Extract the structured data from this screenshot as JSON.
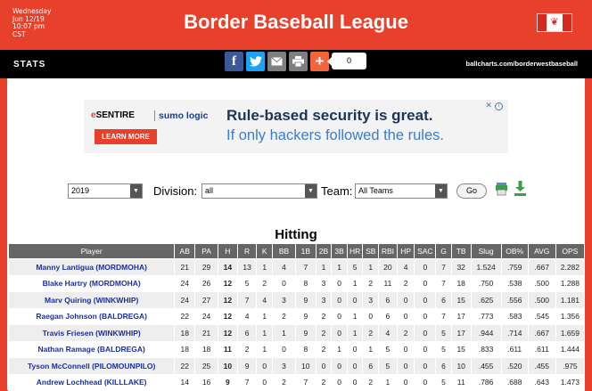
{
  "header": {
    "datetime": [
      "Wednesday",
      "Jun 12/19",
      "10:07 pm",
      "CST"
    ],
    "title": "Border Baseball League"
  },
  "statsbar": {
    "label": "STATS",
    "share_count": "0",
    "site_url": "ballcharts.com/borderwestbaseball",
    "share_buttons": [
      {
        "icon": "facebook-icon",
        "glyph": "f",
        "color": "#3b5998"
      },
      {
        "icon": "twitter-icon",
        "glyph": "t",
        "color": "#1da1f2"
      },
      {
        "icon": "email-icon",
        "glyph": "✉",
        "color": "#7f7f7f"
      },
      {
        "icon": "print-icon",
        "glyph": "⎙",
        "color": "#7f7f7f"
      },
      {
        "icon": "plus-icon",
        "glyph": "+",
        "color": "#f0663a"
      }
    ]
  },
  "ad": {
    "logo1_e": "e",
    "logo1_rest": "SENTIRE",
    "logo2": "sumo logic",
    "button": "LEARN MORE",
    "headline": "Rule-based security is great.",
    "subline": "If only hackers followed the rules."
  },
  "filters": {
    "year": "2019",
    "division_label": "Division:",
    "division": "all",
    "team_label": "Team:",
    "team": "All Teams",
    "go": "Go"
  },
  "table": {
    "title": "Hitting",
    "columns": [
      "Player",
      "AB",
      "PA",
      "H",
      "R",
      "K",
      "BB",
      "1B",
      "2B",
      "3B",
      "HR",
      "SB",
      "RBI",
      "HP",
      "SAC",
      "G",
      "TB",
      "Slug",
      "OB%",
      "AVG",
      "OPS"
    ],
    "rows": [
      [
        "Manny Lantigua (MORDMOHA)",
        "21",
        "29",
        "14",
        "13",
        "1",
        "4",
        "7",
        "1",
        "1",
        "5",
        "1",
        "20",
        "4",
        "0",
        "7",
        "32",
        "1.524",
        ".759",
        ".667",
        "2.282"
      ],
      [
        "Blake Hartry (MORDMOHA)",
        "24",
        "26",
        "12",
        "5",
        "2",
        "0",
        "8",
        "3",
        "0",
        "1",
        "2",
        "11",
        "2",
        "0",
        "7",
        "18",
        ".750",
        ".538",
        ".500",
        "1.288"
      ],
      [
        "Marv Quiring (WINKWHIP)",
        "24",
        "27",
        "12",
        "7",
        "4",
        "3",
        "9",
        "3",
        "0",
        "0",
        "3",
        "6",
        "0",
        "0",
        "6",
        "15",
        ".625",
        ".556",
        ".500",
        "1.181"
      ],
      [
        "Raegan Johnson (BALDREGA)",
        "22",
        "24",
        "12",
        "4",
        "1",
        "2",
        "9",
        "2",
        "0",
        "1",
        "0",
        "6",
        "0",
        "0",
        "7",
        "17",
        ".773",
        ".583",
        ".545",
        "1.356"
      ],
      [
        "Travis Friesen (WINKWHIP)",
        "18",
        "21",
        "12",
        "6",
        "1",
        "1",
        "9",
        "2",
        "0",
        "1",
        "2",
        "4",
        "2",
        "0",
        "5",
        "17",
        ".944",
        ".714",
        ".667",
        "1.659"
      ],
      [
        "Nathan Ramage (BALDREGA)",
        "18",
        "18",
        "11",
        "2",
        "1",
        "0",
        "8",
        "2",
        "1",
        "0",
        "1",
        "5",
        "0",
        "0",
        "5",
        "15",
        ".833",
        ".611",
        ".611",
        "1.444"
      ],
      [
        "Tyson McConnell (PILOMOUNPILO)",
        "22",
        "25",
        "10",
        "9",
        "0",
        "3",
        "10",
        "0",
        "0",
        "0",
        "6",
        "5",
        "0",
        "0",
        "6",
        "10",
        ".455",
        ".520",
        ".455",
        ".975"
      ],
      [
        "Andrew Lochhead (KILLLAKE)",
        "14",
        "16",
        "9",
        "7",
        "0",
        "2",
        "7",
        "2",
        "0",
        "0",
        "2",
        "1",
        "0",
        "0",
        "5",
        "11",
        ".786",
        ".688",
        ".643",
        "1.473"
      ]
    ]
  }
}
